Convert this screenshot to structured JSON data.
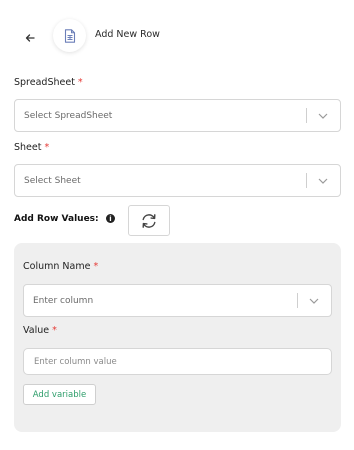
{
  "header": {
    "back_icon": "arrow-left-icon",
    "doc_icon": "document-icon",
    "title": "Add New Row"
  },
  "spreadsheet": {
    "label": "SpreadSheet",
    "required": "*",
    "placeholder": "Select SpreadSheet"
  },
  "sheet": {
    "label": "Sheet",
    "required": "*",
    "placeholder": "Select Sheet"
  },
  "row_values": {
    "label": "Add Row Values:",
    "info_icon": "info-icon",
    "refresh_icon": "refresh-icon"
  },
  "column_name": {
    "label": "Column Name",
    "required": "*",
    "placeholder": "Enter column"
  },
  "value": {
    "label": "Value",
    "required": "*",
    "placeholder": "Enter column value"
  },
  "add_variable_label": "Add variable",
  "colors": {
    "required": "#e53935",
    "accent_green": "#2e9e6b",
    "panel_bg": "#efefef"
  }
}
